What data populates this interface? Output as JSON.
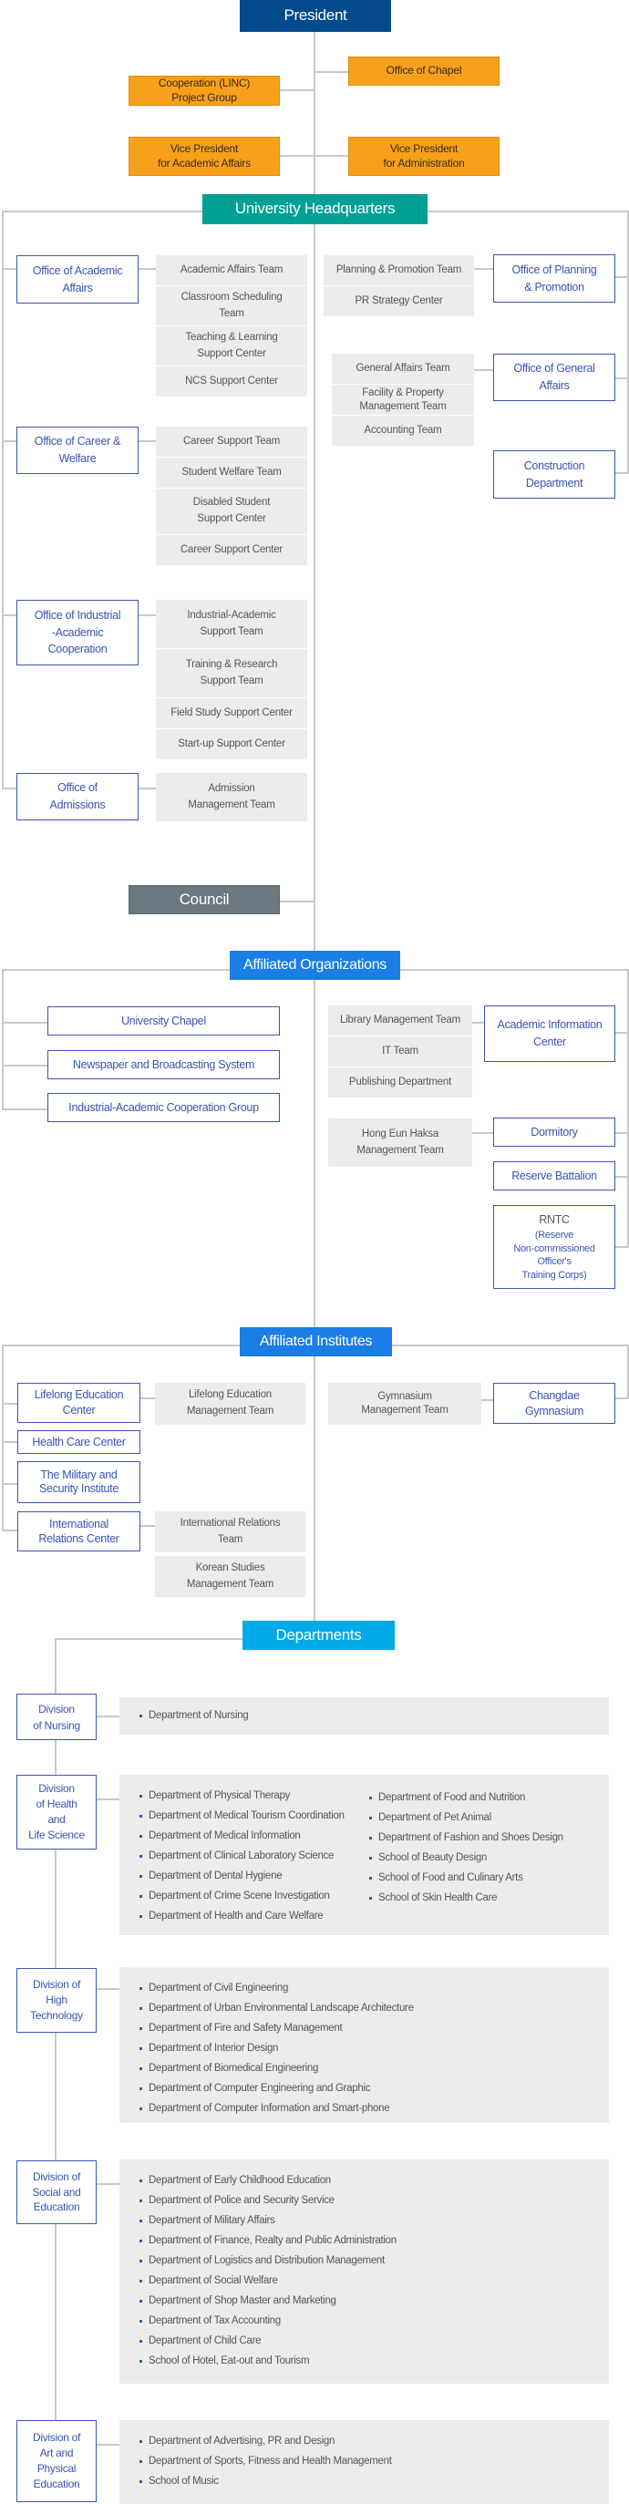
{
  "top": {
    "president": "President",
    "chapel": "Office of Chapel",
    "linc": "Cooperation (LINC)\nProject Group",
    "vp_academic": "Vice President\nfor Academic Affairs",
    "vp_admin": "Vice President\nfor Administration"
  },
  "headquarters": {
    "title": "University Headquarters",
    "academic_affairs": {
      "label": "Office of Academic\nAffairs",
      "teams": [
        "Academic Affairs Team",
        "Classroom Scheduling\nTeam",
        "Teaching & Learning\nSupport Center",
        "NCS Support Center"
      ]
    },
    "career_welfare": {
      "label": "Office of Career &\nWelfare",
      "teams": [
        "Career Support Team",
        "Student Welfare Team",
        "Disabled Student\nSupport Center",
        "Career Support Center"
      ]
    },
    "industrial": {
      "label": "Office of Industrial\n-Academic\nCooperation",
      "teams": [
        "Industrial-Academic\nSupport Team",
        "Training & Research\nSupport Team",
        "Field Study Support Center",
        "Start-up Support Center"
      ]
    },
    "admissions": {
      "label": "Office of\nAdmissions",
      "teams": [
        "Admission\nManagement Team"
      ]
    },
    "planning": {
      "label": "Office of Planning\n& Promotion",
      "teams": [
        "Planning & Promotion Team",
        "PR Strategy Center"
      ]
    },
    "general": {
      "label": "Office of General\nAffairs",
      "teams": [
        "General Affairs Team",
        "Facility & Property\nManagement Team",
        "Accounting Team"
      ]
    },
    "construction": {
      "label": "Construction\nDepartment"
    }
  },
  "council": "Council",
  "affiliated_organizations": {
    "title": "Affiliated Organizations",
    "left": [
      "University Chapel",
      "Newspaper and Broadcasting System",
      "Industrial-Academic Cooperation Group"
    ],
    "academic_info": {
      "label": "Academic Information\nCenter",
      "teams": [
        "Library Management Team",
        "IT Team",
        "Publishing Department"
      ]
    },
    "dormitory": {
      "label": "Dormitory",
      "teams": [
        "Hong Eun Haksa\nManagement Team"
      ]
    },
    "reserve": "Reserve Battalion",
    "rntc": {
      "label": "RNTC",
      "sub": "(Reserve\nNon-commissioned\nOfficer's\nTraining Corps)"
    }
  },
  "affiliated_institutes": {
    "title": "Affiliated Institutes",
    "lifelong": {
      "label": "Lifelong Education\nCenter",
      "teams": [
        "Lifelong Education\nManagement Team"
      ]
    },
    "health": "Health Care Center",
    "military": "The Military and\nSecurity Institute",
    "international": {
      "label": "International\nRelations Center",
      "teams": [
        "International Relations\nTeam",
        "Korean Studies\nManagement Team"
      ]
    },
    "gymnasium": {
      "label": "Changdae\nGymnasium",
      "teams": [
        "Gymnasium\nManagement Team"
      ]
    }
  },
  "departments": {
    "title": "Departments",
    "divisions": [
      {
        "label": "Division\nof Nursing",
        "col1": [
          "Department of Nursing"
        ]
      },
      {
        "label": "Division\nof Health\nand\nLife Science",
        "col1": [
          "Department of Physical Therapy",
          "Department of Medical Tourism Coordination",
          "Department of Medical Information",
          "Department of Clinical Laboratory Science",
          "Department of Dental Hygiene",
          "Department of Crime Scene Investigation",
          "Department of Health and Care Welfare"
        ],
        "col2": [
          "Department of Food and Nutrition",
          "Department of Pet Animal",
          "Department of Fashion and Shoes Design",
          "School of Beauty Design",
          "School of Food and Culinary Arts",
          "School of Skin Health Care"
        ]
      },
      {
        "label": "Division of\nHigh\nTechnology",
        "col1": [
          "Department of Civil Engineering",
          "Department of Urban Environmental Landscape Architecture",
          "Department of Fire and Safety Management",
          "Department of Interior Design",
          "Department of Biomedical Engineering",
          "Department of Computer Engineering and Graphic",
          "Department of Computer Information and Smart-phone"
        ]
      },
      {
        "label": "Division of\nSocial and\nEducation",
        "col1": [
          "Department of Early Childhood Education",
          "Department of Police and Security Service",
          "Department of Military Affairs",
          "Department of Finance, Realty and Public Administration",
          "Department of Logistics and Distribution Management",
          "Department of Social Welfare",
          "Department of Shop Master and Marketing",
          "Department of Tax Accounting",
          "Department of Child Care",
          "School of Hotel, Eat-out and Tourism"
        ]
      },
      {
        "label": "Division of\nArt and\nPhysical\nEducation",
        "col1": [
          "Department of Advertising, PR and Design",
          "Department of Sports, Fitness and Health Management",
          "School of Music"
        ]
      }
    ]
  },
  "colors": {
    "president": "#034a8c",
    "vice": "#f6a01c",
    "headquarters": "#00a095",
    "council": "#6c7880",
    "affiliated": "#1a7ee6",
    "departments": "#00aae8",
    "unit_text": "#3a55b4",
    "team_bg": "#ececec"
  }
}
